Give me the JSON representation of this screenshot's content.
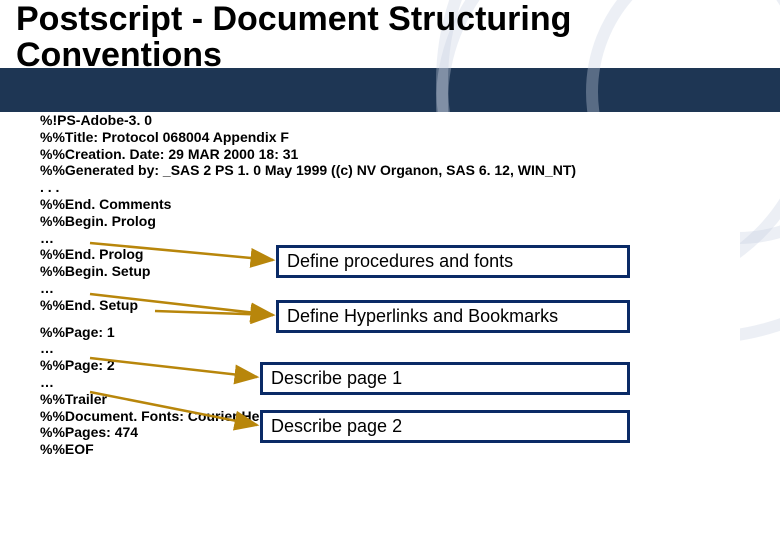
{
  "title": "Postscript - Document Structuring Conventions",
  "code": {
    "l1": "%!PS-Adobe-3. 0",
    "l2": "%%Title: Protocol 068004 Appendix F",
    "l3": "%%Creation. Date: 29 MAR 2000 18: 31",
    "l4": "%%Generated by: _SAS 2 PS 1. 0 May 1999 ((c) NV Organon, SAS 6. 12, WIN_NT)",
    "l5": ". . .",
    "l6": "%%End. Comments",
    "l7": "%%Begin. Prolog",
    "l8": "…",
    "l9": "%%End. Prolog",
    "l10": "%%Begin. Setup",
    "l11": "…",
    "l12": "%%End. Setup",
    "l13": "%%Page: 1",
    "l14": "…",
    "l15": "%%Page: 2",
    "l16": "…",
    "l17": "%%Trailer",
    "l18": "%%Document. Fonts: Courier Helvetica-Bold Helvetica",
    "l19": "%%Pages: 474",
    "l20": "%%EOF"
  },
  "annotations": {
    "a1": "Define procedures and fonts",
    "a2": "Define Hyperlinks and Bookmarks",
    "a3": "Describe page 1",
    "a4": "Describe page 2"
  }
}
